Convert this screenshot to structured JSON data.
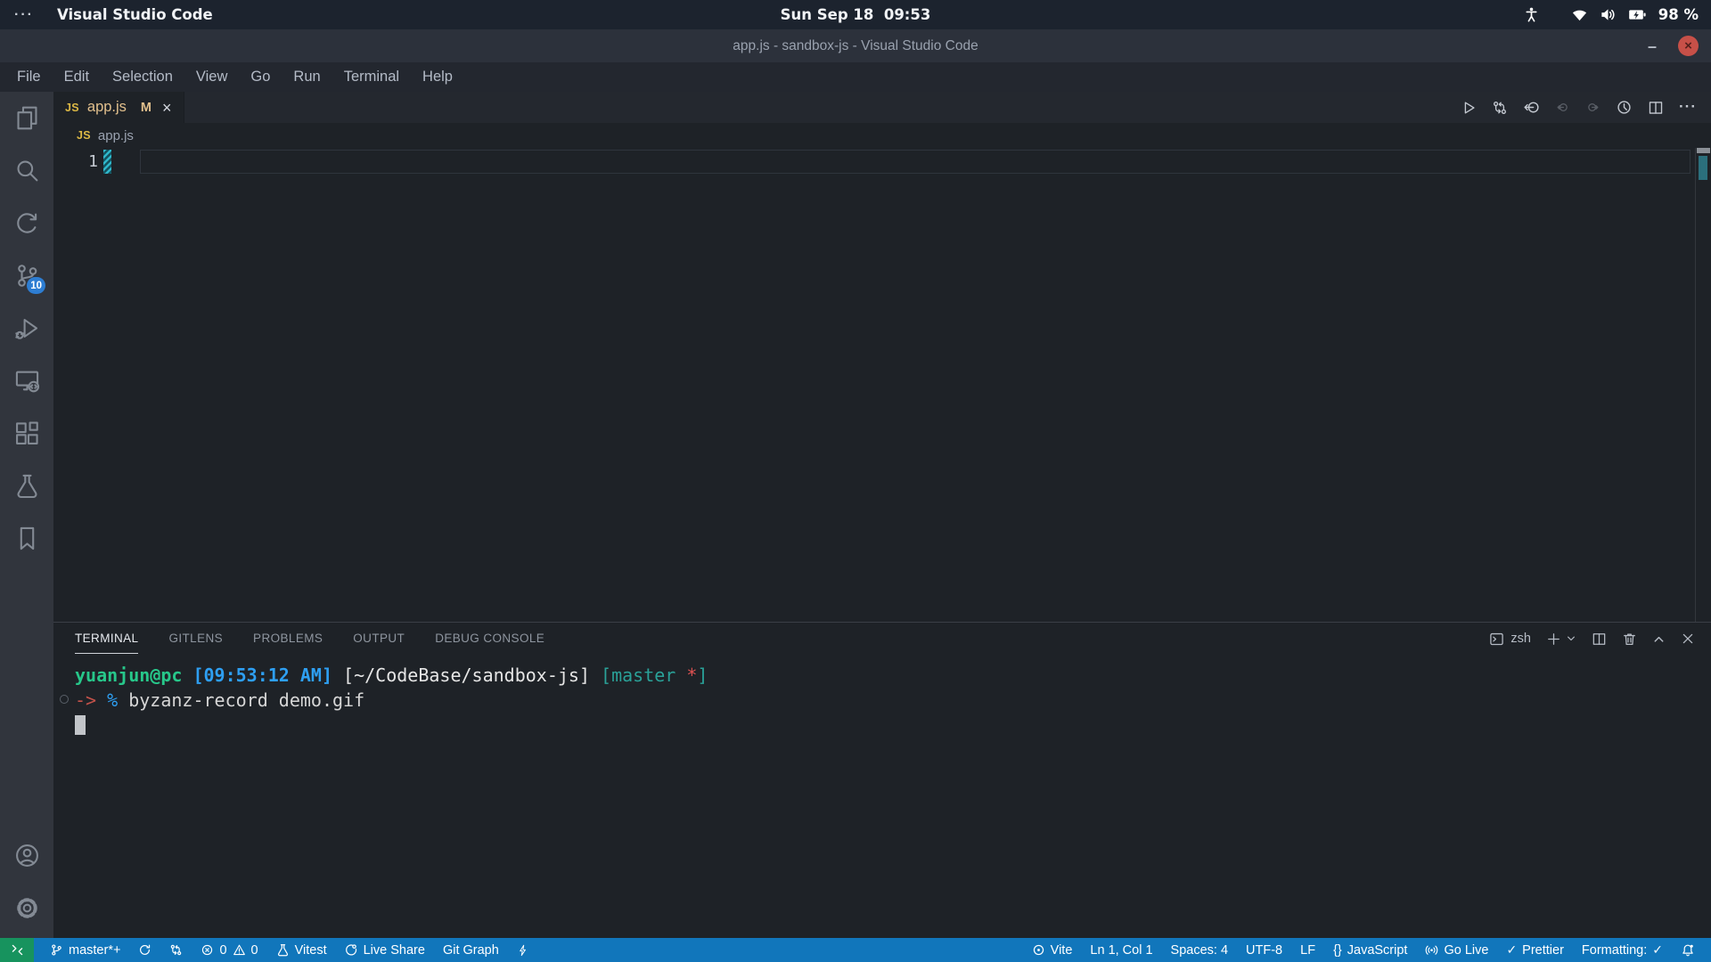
{
  "system_bar": {
    "menu_dots": "···",
    "app_name": "Visual Studio Code",
    "clock": "Sun Sep 18  09:53",
    "battery_percent": "98 %"
  },
  "title_bar": {
    "title": "app.js - sandbox-js - Visual Studio Code",
    "minimize_glyph": "–",
    "close_glyph": "×"
  },
  "menu_bar": {
    "items": [
      "File",
      "Edit",
      "Selection",
      "View",
      "Go",
      "Run",
      "Terminal",
      "Help"
    ]
  },
  "activity_bar": {
    "source_control_badge": "10"
  },
  "editor": {
    "tab": {
      "icon_label": "JS",
      "file_name": "app.js",
      "modified_badge": "M",
      "close_glyph": "×"
    },
    "breadcrumb": {
      "icon_label": "JS",
      "file_name": "app.js"
    },
    "line_number": "1",
    "more_actions_glyph": "···"
  },
  "panel": {
    "tabs": [
      "TERMINAL",
      "GITLENS",
      "PROBLEMS",
      "OUTPUT",
      "DEBUG CONSOLE"
    ],
    "active_tab": "TERMINAL",
    "shell_label": "zsh",
    "terminal": {
      "user": "yuanjun@pc",
      "time_segment": " [09:53:12 AM]",
      "path_segment": " [~/CodeBase/sandbox-js]",
      "branch_open": " [master ",
      "branch_star": "*",
      "branch_close": "]",
      "arrow": "-> ",
      "percent": "% ",
      "command": "byzanz-record demo.gif"
    }
  },
  "status_bar": {
    "branch": "master*+",
    "error_count": "0",
    "warning_count": "0",
    "vitest_label": "Vitest",
    "live_share_label": "Live Share",
    "git_graph_label": "Git Graph",
    "vite_label": "Vite",
    "cursor_position": "Ln 1, Col 1",
    "indentation": "Spaces: 4",
    "encoding": "UTF-8",
    "eol": "LF",
    "language_braces": "{}",
    "language": "JavaScript",
    "go_live_label": "Go Live",
    "prettier_label": "Prettier",
    "formatting_label": "Formatting:",
    "check_glyph": "✓"
  },
  "colors": {
    "status_bar_bg": "#1176bb",
    "remote_indicator_bg": "#17935e",
    "modified_file_text": "#e2c08d",
    "js_icon_gold": "#dcb845",
    "source_control_badge_bg": "#2d7dd2",
    "terminal_green": "#27c78a",
    "terminal_blue": "#2e9ff2",
    "terminal_teal": "#2aa198",
    "terminal_red_arrow": "#c4524a",
    "terminal_red_star": "#e05252",
    "modified_gutter_teal": "#2fb6c9",
    "close_button_bg": "#c75048"
  }
}
